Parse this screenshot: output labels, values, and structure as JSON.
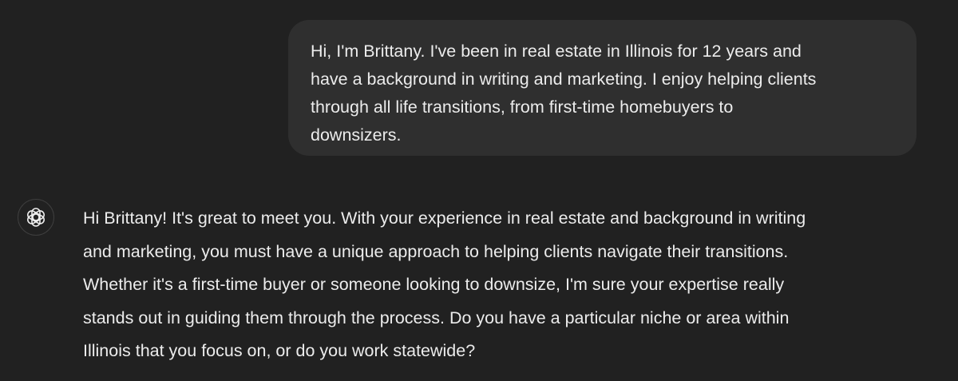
{
  "conversation": {
    "user_message": {
      "text": "Hi, I'm Brittany. I've been in real estate in Illinois for 12 years and\nhave a background in writing and marketing. I enjoy helping clients\nthrough all life transitions, from first-time homebuyers to\ndownsizers."
    },
    "assistant_message": {
      "avatar_icon": "openai-logo-icon",
      "text": "Hi Brittany! It's great to meet you. With your experience in real estate and background in writing\nand marketing, you must have a unique approach to helping clients navigate their transitions.\nWhether it's a first-time buyer or someone looking to downsize, I'm sure your expertise really\nstands out in guiding them through the process. Do you have a particular niche or area within\nIllinois that you focus on, or do you work statewide?"
    }
  },
  "colors": {
    "background": "#212121",
    "user_bubble": "#2f2f2f",
    "text": "#ececec",
    "avatar_border": "#3f3f3f"
  }
}
